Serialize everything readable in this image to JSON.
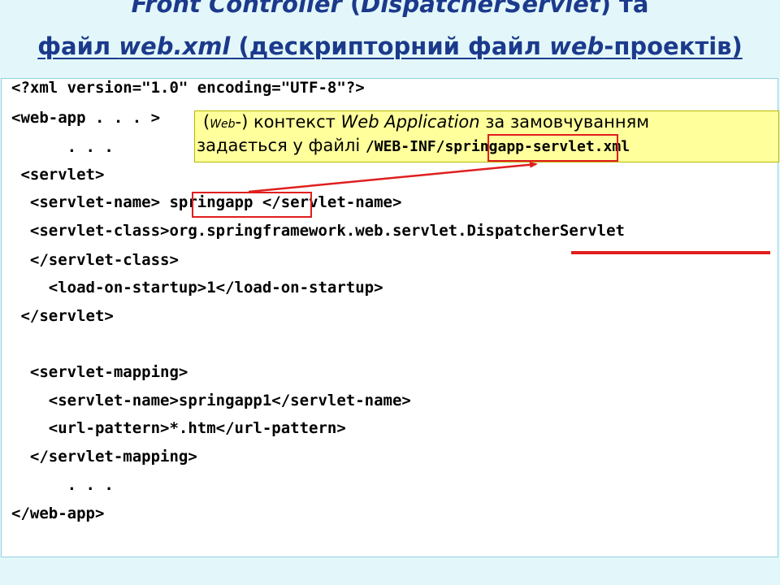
{
  "title": {
    "line1": {
      "part1": "Front Controller",
      "part2": " (",
      "part3": "DispatcherServlet",
      "part4": ") та"
    },
    "line2": {
      "part1": "файл ",
      "part2": "web.xml",
      "part3": " (дескрипторний файл ",
      "part4": "web",
      "part5": "-проектів)"
    }
  },
  "code": {
    "lines": [
      "<?xml version=\"1.0\" encoding=\"UTF-8\"?>",
      "<web-app . . . >",
      "      . . .",
      " <servlet>",
      "  <servlet-name> springapp </servlet-name>",
      "  <servlet-class>org.springframework.web.servlet.DispatcherServlet",
      "  </servlet-class>",
      "    <load-on-startup>1</load-on-startup>",
      " </servlet>",
      "",
      "  <servlet-mapping>",
      "    <servlet-name>springapp1</servlet-name>",
      "    <url-pattern>*.htm</url-pattern>",
      "  </servlet-mapping>",
      "      . . .",
      "</web-app>"
    ]
  },
  "note": {
    "open_paren": "(",
    "web_small": "Web",
    "suffix": "-) контекст ",
    "web_application": "Web Application",
    "by_default": " за замовчуванням",
    "line2_text": "задається у файлі ",
    "path": "/WEB-INF/springapp-servlet.xml"
  },
  "colors": {
    "background": "#e3f7fa",
    "title": "#1b3a8c",
    "highlight": "#e01e1e",
    "note_background": "#ffff9c"
  }
}
